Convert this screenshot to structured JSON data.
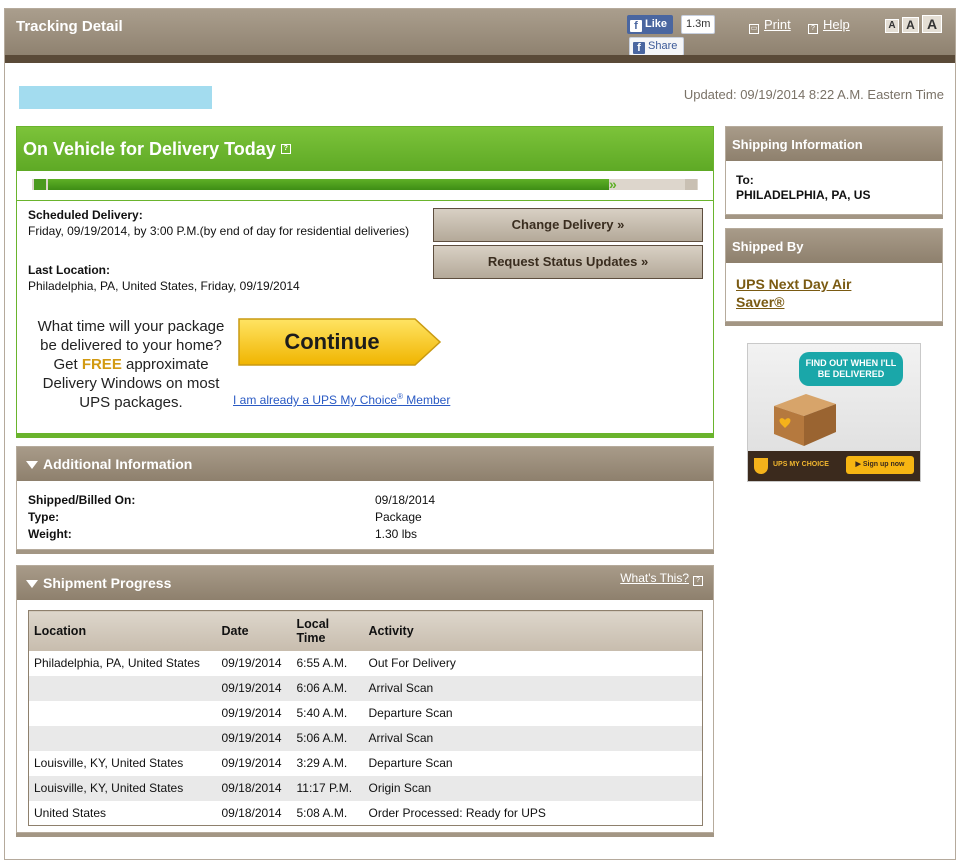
{
  "header": {
    "title": "Tracking Detail",
    "fb_like_label": "Like",
    "fb_like_count": "1.3m",
    "fb_share_label": "Share",
    "print_label": "Print",
    "help_label": "Help",
    "text_sizes": [
      "A",
      "A",
      "A"
    ]
  },
  "updated_text": "Updated: 09/19/2014 8:22 A.M. Eastern Time",
  "status": {
    "title": "On Vehicle for Delivery Today",
    "progress": 0.9,
    "scheduled_label": "Scheduled Delivery:",
    "scheduled_value": "Friday, 09/19/2014, by 3:00 P.M.(by end of day for residential deliveries)",
    "last_location_label": "Last Location:",
    "last_location_value": "Philadelphia, PA, United States, Friday, 09/19/2014",
    "change_delivery_label": "Change Delivery »",
    "request_updates_label": "Request Status Updates »",
    "promo_line1": "What time will your package be delivered to your home? Get",
    "promo_free": "FREE",
    "promo_line2": "approximate Delivery Windows on most UPS packages.",
    "continue_label": "Continue",
    "member_link_pre": "I am already a UPS My Choice",
    "member_link_sup": "®",
    "member_link_post": " Member"
  },
  "additional_info": {
    "title": "Additional Information",
    "rows": [
      {
        "label": "Shipped/Billed On:",
        "value": "09/18/2014"
      },
      {
        "label": "Type:",
        "value": "Package"
      },
      {
        "label": "Weight:",
        "value": "1.30 lbs"
      }
    ]
  },
  "shipment_progress": {
    "title": "Shipment Progress",
    "whats_this": "What's This?",
    "columns": [
      "Location",
      "Date",
      "Local Time",
      "Activity"
    ],
    "rows": [
      {
        "location": "Philadelphia, PA, United States",
        "date": "09/19/2014",
        "time": "6:55 A.M.",
        "activity": "Out For Delivery"
      },
      {
        "location": "",
        "date": "09/19/2014",
        "time": "6:06 A.M.",
        "activity": "Arrival Scan"
      },
      {
        "location": "",
        "date": "09/19/2014",
        "time": "5:40 A.M.",
        "activity": "Departure Scan"
      },
      {
        "location": "",
        "date": "09/19/2014",
        "time": "5:06 A.M.",
        "activity": "Arrival Scan"
      },
      {
        "location": "Louisville, KY, United States",
        "date": "09/19/2014",
        "time": "3:29 A.M.",
        "activity": "Departure Scan"
      },
      {
        "location": "Louisville, KY, United States",
        "date": "09/18/2014",
        "time": "11:17 P.M.",
        "activity": "Origin Scan"
      },
      {
        "location": "United States",
        "date": "09/18/2014",
        "time": "5:08 A.M.",
        "activity": "Order Processed: Ready for UPS"
      }
    ]
  },
  "shipping_info": {
    "title": "Shipping Information",
    "to_label": "To:",
    "to_value": "PHILADELPHIA, PA, US"
  },
  "shipped_by": {
    "title": "Shipped By",
    "service": "UPS Next Day Air Saver®"
  },
  "ad": {
    "headline": "FIND OUT WHEN I'LL BE DELIVERED",
    "brand": "UPS MY CHOICE",
    "cta": "Sign up now"
  },
  "colors": {
    "status_green": "#6ab42d",
    "header_brown": "#8f8270",
    "continue_yellow": "#f7c51a",
    "link_blue": "#2a5ac4",
    "service_link_brown": "#7a5a12"
  }
}
